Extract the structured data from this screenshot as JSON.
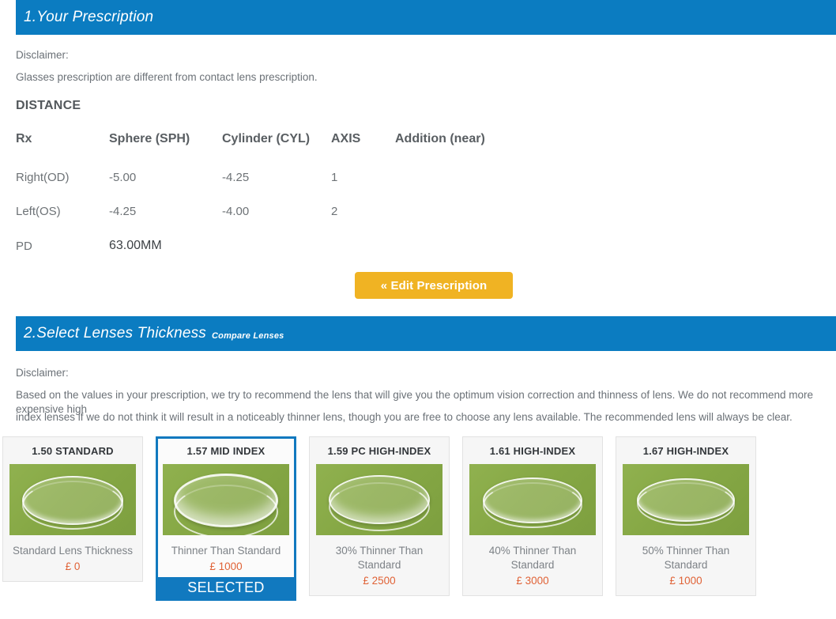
{
  "section1": {
    "title": "1.Your Prescription",
    "disclaimer_label": "Disclaimer:",
    "disclaimer_text": "Glasses prescription are different from contact lens prescription.",
    "distance_heading": "DISTANCE",
    "table": {
      "headers": [
        "Rx",
        "Sphere (SPH)",
        "Cylinder (CYL)",
        "AXIS",
        "Addition (near)"
      ],
      "rows": [
        {
          "label": "Right(OD)",
          "sph": "-5.00",
          "cyl": "-4.25",
          "axis": "1",
          "add": ""
        },
        {
          "label": "Left(OS)",
          "sph": "-4.25",
          "cyl": "-4.00",
          "axis": "2",
          "add": ""
        }
      ],
      "pd_label": "PD",
      "pd_value": "63.00MM"
    },
    "edit_button": "« Edit Prescription"
  },
  "section2": {
    "title": "2.Select Lenses Thickness",
    "subtitle": "Compare Lenses",
    "disclaimer_label": "Disclaimer:",
    "disclaimer_line1": "Based on the values in your prescription, we try to recommend the lens that will give you the optimum vision correction and thinness of lens. We do not recommend more expensive high",
    "disclaimer_line2": "index lenses if we do not think it will result in a noticeably thinner lens, though you are free to choose any lens available. The recommended lens will always be clear.",
    "selected_label": "SELECTED",
    "lenses": [
      {
        "title": "1.50 STANDARD",
        "desc": "Standard Lens Thickness",
        "price": "£ 0",
        "selected": false
      },
      {
        "title": "1.57 MID INDEX",
        "desc": "Thinner Than Standard",
        "price": "£ 1000",
        "selected": true
      },
      {
        "title": "1.59 PC HIGH-INDEX",
        "desc": "30% Thinner Than Standard",
        "price": "£ 2500",
        "selected": false
      },
      {
        "title": "1.61 HIGH-INDEX",
        "desc": "40% Thinner Than Standard",
        "price": "£ 3000",
        "selected": false
      },
      {
        "title": "1.67 HIGH-INDEX",
        "desc": "50% Thinner Than Standard",
        "price": "£ 1000",
        "selected": false
      }
    ]
  },
  "colors": {
    "header_blue": "#0b7cc1",
    "button_amber": "#f0b323",
    "price_orange": "#e06236",
    "selected_blue": "#1179bf",
    "lens_image_green": "#86a845"
  }
}
